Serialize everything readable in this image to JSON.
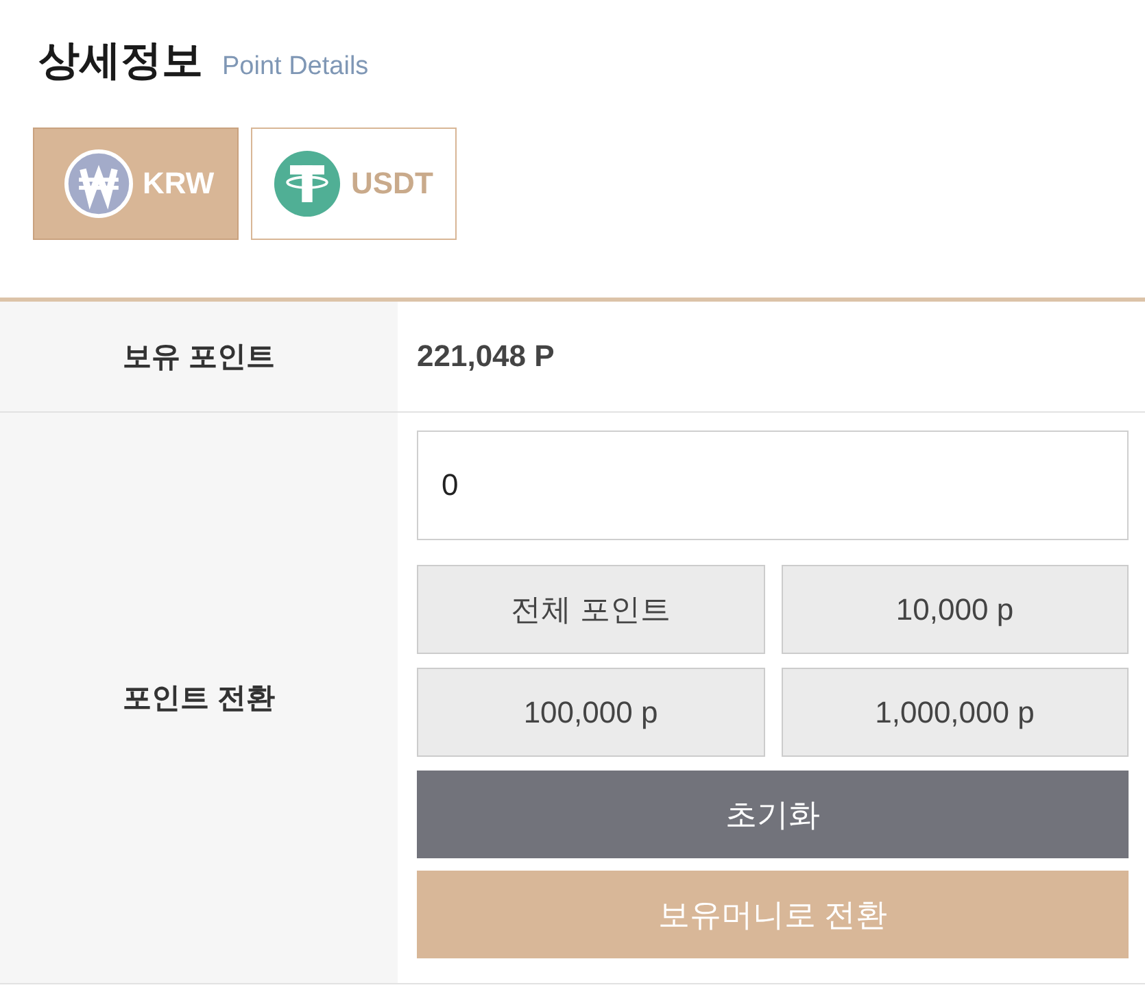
{
  "header": {
    "title": "상세정보",
    "subtitle": "Point Details"
  },
  "currency_tabs": [
    {
      "label": "KRW",
      "kind": "krw",
      "selected": true
    },
    {
      "label": "USDT",
      "kind": "usdt",
      "selected": false
    }
  ],
  "table": {
    "rows": [
      {
        "kind": "text",
        "label": "보유 포인트",
        "value": "221,048 P"
      },
      {
        "kind": "form",
        "label": "포인트 전환",
        "input": {
          "value": "0"
        },
        "quick_buttons": [
          "전체 포인트",
          "10,000 p",
          "100,000 p",
          "1,000,000 p"
        ],
        "buttons": [
          {
            "label": "초기화",
            "kind": "reset"
          },
          {
            "label": "보유머니로 전환",
            "kind": "convert"
          }
        ]
      }
    ]
  }
}
